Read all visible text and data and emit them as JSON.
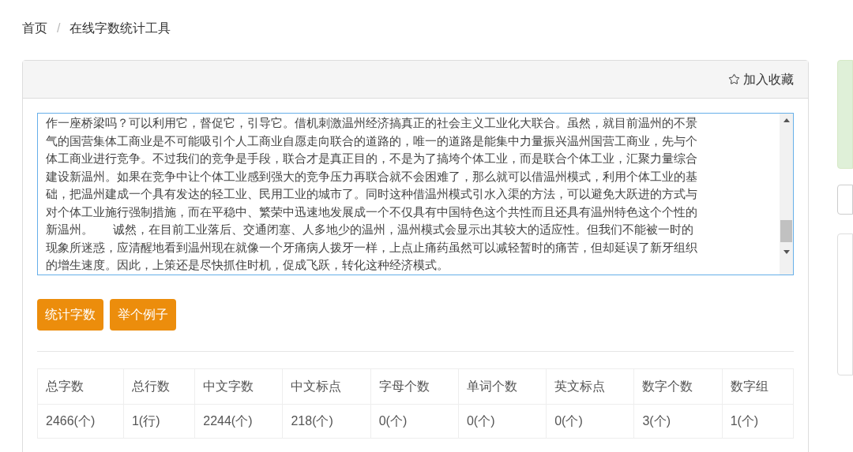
{
  "breadcrumb": [
    {
      "label": "首页"
    },
    {
      "separator": "/",
      "label": "在线字数统计工具"
    }
  ],
  "panel": {
    "favorite_label": "加入收藏"
  },
  "editor": {
    "lines": [
      "作一座桥梁吗？可以利用它，督促它，引导它。借机刺激温州经济搞真正的社会主义工业化大联合。虽然，就目前温州的不景",
      "气的国营集体工商业是不可能吸引个人工商业自愿走向联合的道路的，唯一的道路是能集中力量振兴温州国营工商业，先与个",
      "体工商业进行竞争。不过我们的竞争是手段，联合才是真正目的，不是为了搞垮个体工业，而是联合个体工业，汇聚力量综合",
      "建设新温州。如果在竞争中让个体工业感到强大的竞争压力再联合就不会困难了，那么就可以借温州模式，利用个体工业的基",
      "础，把温州建成一个具有发达的轻工业、民用工业的城市了。同时这种借温州模式引水入渠的方法，可以避免大跃进的方式与",
      "对个体工业施行强制措施，而在平稳中、繁荣中迅速地发展成一个不仅具有中国特色这个共性而且还具有温州特色这个个性的",
      "新温州。      诚然，在目前工业落后、交通闭塞、人多地少的温州，温州模式会显示出其较大的适应性。但我们不能被一时的",
      "现象所迷惑，应清醒地看到温州现在就像一个牙痛病人拨牙一样，上点止痛药虽然可以减轻暂时的痛苦，但却延误了新牙组织",
      "的增生速度。因此，上策还是尽快抓住时机，促成飞跃，转化这种经济模式。"
    ]
  },
  "buttons": [
    {
      "label": "统计字数"
    },
    {
      "label": "举个例子"
    }
  ],
  "table": {
    "columns": [
      "总字数",
      "总行数",
      "中文字数",
      "中文标点",
      "字母个数",
      "单词个数",
      "英文标点",
      "数字个数",
      "数字组"
    ],
    "rows": [
      [
        "2466(个)",
        "1(行)",
        "2244(个)",
        "218(个)",
        "0(个)",
        "0(个)",
        "0(个)",
        "3(个)",
        "1(个)"
      ]
    ]
  }
}
